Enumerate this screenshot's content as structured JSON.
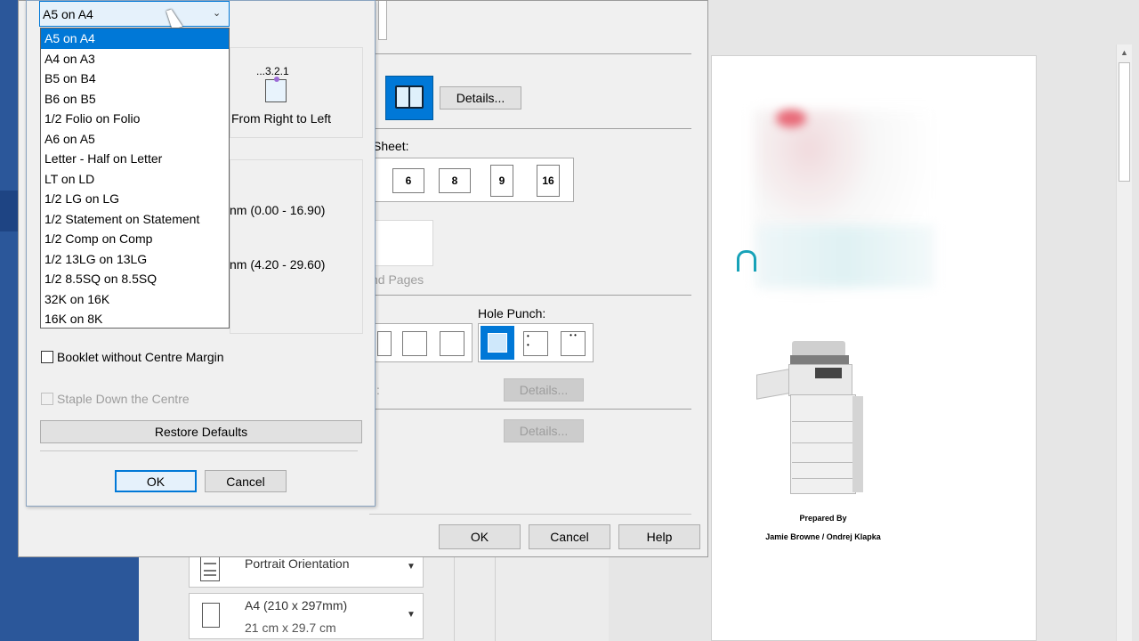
{
  "colors": {
    "accent": "#0078d7",
    "taskbar_blue": "#2b579a",
    "dialog_bg": "#f0f0f0",
    "page_bg": "#e6e6e6"
  },
  "dropdown": {
    "selected": "A5 on A4",
    "options": [
      "A5 on A4",
      "A4 on A3",
      "B5 on B4",
      "B6 on B5",
      "1/2 Folio on Folio",
      "A6 on A5",
      "Letter - Half on Letter",
      "LT on LD",
      "1/2 LG on LG",
      "1/2 Statement on Statement",
      "1/2 Comp on Comp",
      "1/2 13LG on 13LG",
      "1/2 8.5SQ on 8.5SQ",
      "32K on 16K",
      "16K on 8K"
    ]
  },
  "booklet_dialog": {
    "order_caption": "...3.2.1",
    "order_label": "From Right to Left",
    "range1": "nm (0.00 - 16.90)",
    "range2": "nm (4.20 - 29.60)",
    "booklet_no_margin": "Booklet without Centre Margin",
    "staple_centre": "Staple Down the Centre",
    "restore": "Restore Defaults",
    "ok": "OK",
    "cancel": "Cancel"
  },
  "main_dialog": {
    "details": "Details...",
    "per_sheet": "Sheet:",
    "pages_per_sheet": [
      "6",
      "8",
      "9",
      "16"
    ],
    "bind_pages": "nd Pages",
    "hole_punch": "Hole Punch:",
    "colon_label": ":",
    "ok": "OK",
    "cancel": "Cancel",
    "help": "Help"
  },
  "print_settings": {
    "orientation": "Portrait Orientation",
    "paper_size": "A4 (210 x 297mm)",
    "paper_dims": "21 cm x 29.7 cm"
  },
  "preview": {
    "prepared_by": "Prepared By",
    "authors": "Jamie Browne / Ondrej Klapka"
  }
}
